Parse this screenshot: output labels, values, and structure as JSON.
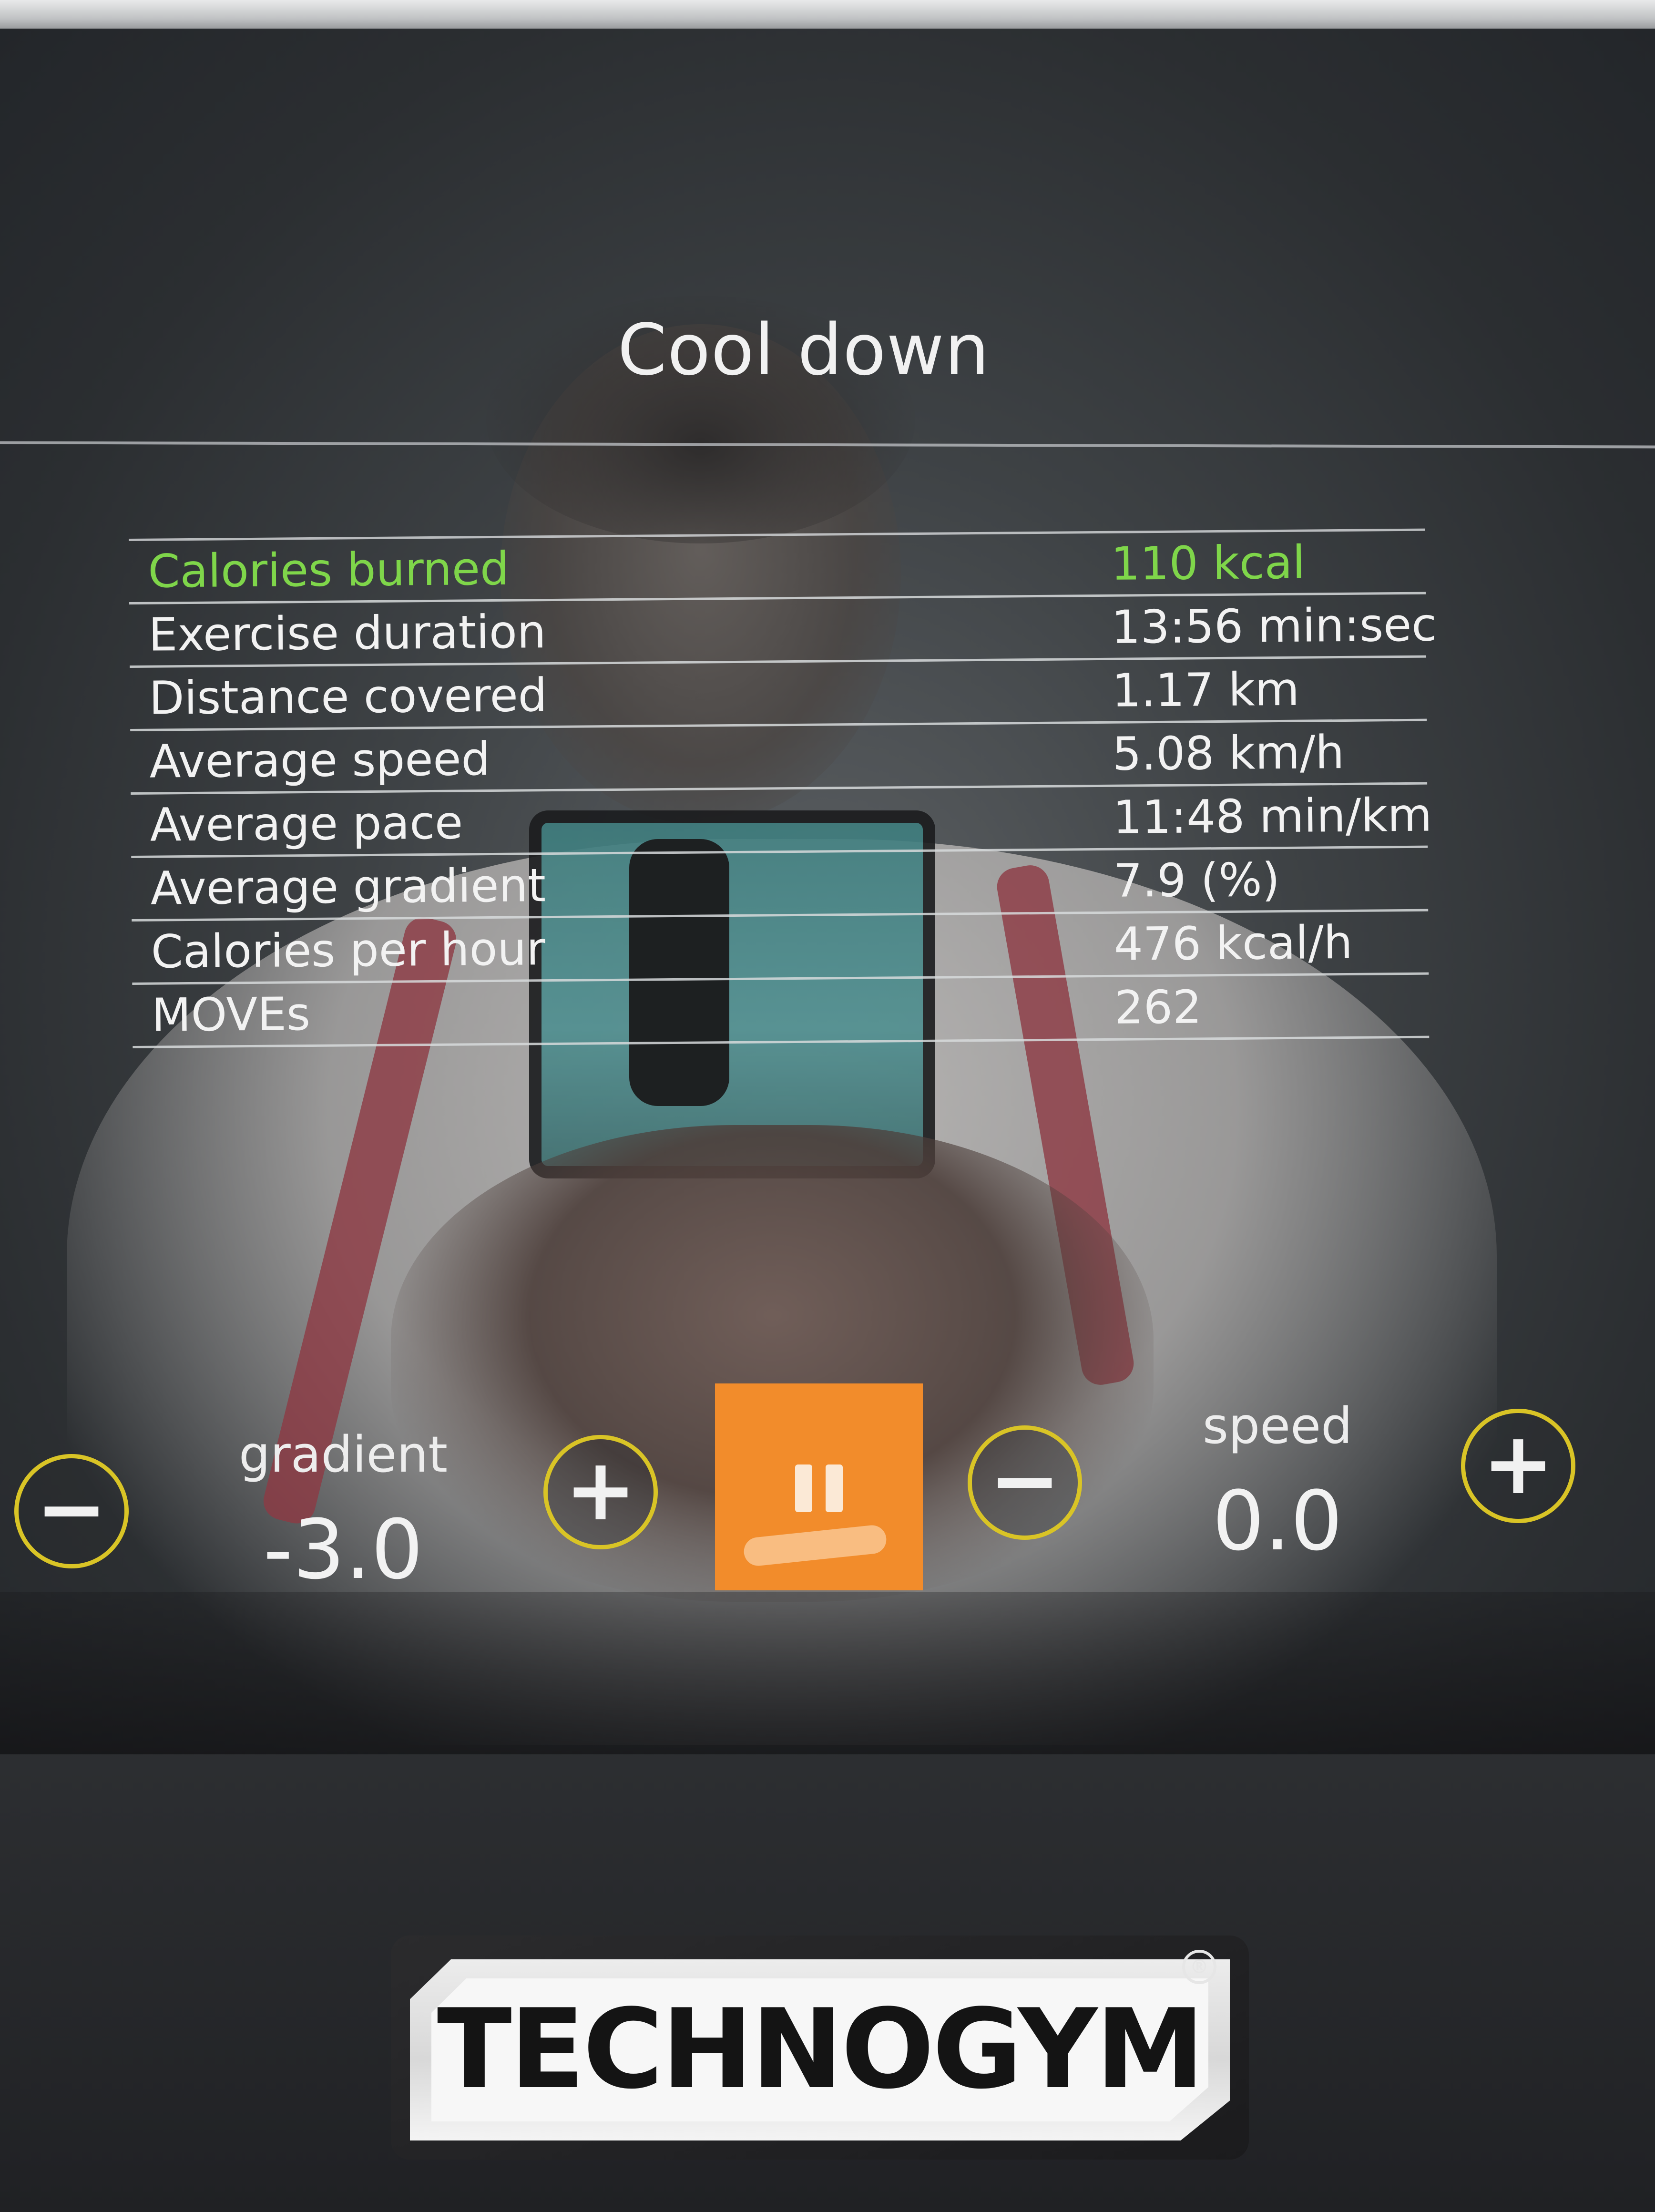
{
  "screen": {
    "title": "Cool down"
  },
  "stats": [
    {
      "label": "Calories burned",
      "value": "110 kcal"
    },
    {
      "label": "Exercise duration",
      "value": "13:56 min:sec"
    },
    {
      "label": "Distance covered",
      "value": "1.17 km"
    },
    {
      "label": "Average speed",
      "value": "5.08 km/h"
    },
    {
      "label": "Average pace",
      "value": "11:48 min/km"
    },
    {
      "label": "Average gradient",
      "value": "7.9 (%)"
    },
    {
      "label": "Calories per hour",
      "value": "476 kcal/h"
    },
    {
      "label": "MOVEs",
      "value": "262"
    }
  ],
  "controls": {
    "gradient": {
      "label": "gradient",
      "value": "-3.0",
      "decrease_symbol": "−",
      "increase_symbol": "+"
    },
    "speed": {
      "label": "speed",
      "value": "0.0",
      "decrease_symbol": "−",
      "increase_symbol": "+"
    },
    "pause_icon": "pause-icon"
  },
  "brand": {
    "logo_text": "TECHNOGYM",
    "registered_mark": "®"
  },
  "colors": {
    "highlight_green": "#7fd64a",
    "control_ring_yellow": "#d9c426",
    "pause_orange": "#f28c2b"
  }
}
